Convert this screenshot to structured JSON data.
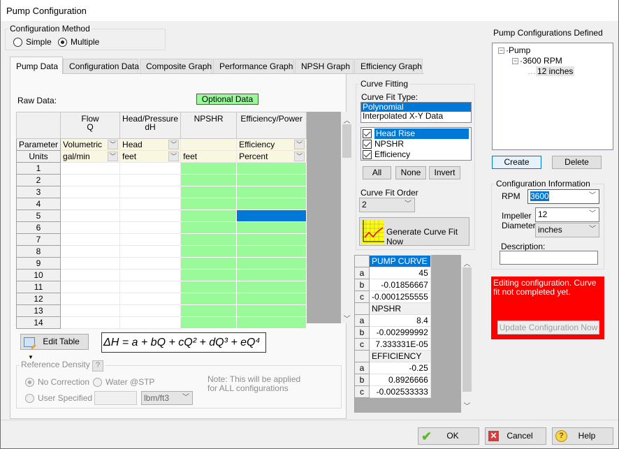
{
  "window": {
    "title": "Pump Configuration"
  },
  "config_method": {
    "legend": "Configuration Method",
    "options": [
      {
        "label": "Simple",
        "selected": false
      },
      {
        "label": "Multiple",
        "selected": true
      }
    ]
  },
  "tabs": [
    {
      "label": "Pump Data",
      "active": true
    },
    {
      "label": "Configuration Data",
      "active": false
    },
    {
      "label": "Composite Graph",
      "active": false
    },
    {
      "label": "Performance Graph",
      "active": false
    },
    {
      "label": "NPSH Graph",
      "active": false
    },
    {
      "label": "Efficiency Graph",
      "active": false
    }
  ],
  "raw_data": {
    "label": "Raw Data:",
    "optional_badge": "Optional Data",
    "columns": [
      {
        "header_line1": "Flow",
        "header_line2": "Q",
        "parameter": "Volumetric",
        "units": "gal/min"
      },
      {
        "header_line1": "Head/Pressure",
        "header_line2": "dH",
        "parameter": "Head",
        "units": "feet"
      },
      {
        "header_line1": "NPSHR",
        "header_line2": "",
        "parameter": "",
        "units": "feet"
      },
      {
        "header_line1": "Efficiency/Power",
        "header_line2": "",
        "parameter": "Efficiency",
        "units": "Percent"
      }
    ],
    "row_labels": {
      "parameter": "Parameter",
      "units": "Units"
    },
    "rows": [
      "1",
      "2",
      "3",
      "4",
      "5",
      "6",
      "7",
      "8",
      "9",
      "10",
      "11",
      "12",
      "13",
      "14"
    ],
    "selected_cell": {
      "row": "5",
      "column": "Efficiency/Power"
    }
  },
  "edit_table": {
    "label": "Edit Table"
  },
  "equation": {
    "lhs": "ΔH",
    "rhs": "a + bQ + cQ² + dQ³ + eQ⁴"
  },
  "reference_density": {
    "legend": "Reference Density",
    "help": "?",
    "options": [
      {
        "label": "No Correction",
        "selected": true
      },
      {
        "label": "Water @STP",
        "selected": false
      },
      {
        "label": "User Specified",
        "selected": false
      }
    ],
    "user_value": "",
    "units": "lbm/ft3",
    "note_line1": "Note: This will be applied",
    "note_line2": "for ALL configurations"
  },
  "curve_fitting": {
    "legend": "Curve Fitting",
    "type_label": "Curve Fit Type:",
    "types": [
      {
        "label": "Polynomial",
        "selected": true
      },
      {
        "label": "Interpolated X-Y Data",
        "selected": false
      }
    ],
    "curves": [
      {
        "label": "Head Rise",
        "checked": true,
        "selected": true
      },
      {
        "label": "NPSHR",
        "checked": true,
        "selected": false
      },
      {
        "label": "Efficiency",
        "checked": true,
        "selected": false
      }
    ],
    "all_label": "All",
    "none_label": "None",
    "invert_label": "Invert",
    "order_label": "Curve Fit Order",
    "order_value": "2",
    "generate_label": "Generate Curve Fit Now"
  },
  "coefficients": [
    {
      "section": "PUMP CURVE",
      "selected": true,
      "rows": [
        {
          "k": "a",
          "v": "45"
        },
        {
          "k": "b",
          "v": "-0.01856667"
        },
        {
          "k": "c",
          "v": "-0.0001255555"
        }
      ]
    },
    {
      "section": "NPSHR",
      "selected": false,
      "rows": [
        {
          "k": "a",
          "v": "8.4"
        },
        {
          "k": "b",
          "v": "-0.002999992"
        },
        {
          "k": "c",
          "v": "7.333331E-05"
        }
      ]
    },
    {
      "section": "EFFICIENCY",
      "selected": false,
      "rows": [
        {
          "k": "a",
          "v": "-0.25"
        },
        {
          "k": "b",
          "v": "0.8926666"
        },
        {
          "k": "c",
          "v": "-0.002533333"
        }
      ]
    }
  ],
  "configs_defined": {
    "label": "Pump Configurations Defined",
    "tree": {
      "root": "Pump",
      "child": "3600 RPM",
      "leaf": "12 inches"
    },
    "create_label": "Create",
    "delete_label": "Delete"
  },
  "config_info": {
    "legend": "Configuration Information",
    "rpm_label": "RPM",
    "rpm_value": "3600",
    "impeller_label_1": "Impeller",
    "impeller_label_2": "Diameter:",
    "impeller_value": "12",
    "impeller_units": "inches",
    "description_label": "Description:",
    "description_value": ""
  },
  "status": {
    "message": "Editing configuration. Curve fit not completed yet.",
    "update_label": "Update Configuration Now",
    "color": "#ff0000"
  },
  "footer": {
    "ok_label": "OK",
    "cancel_label": "Cancel",
    "help_label": "Help"
  }
}
